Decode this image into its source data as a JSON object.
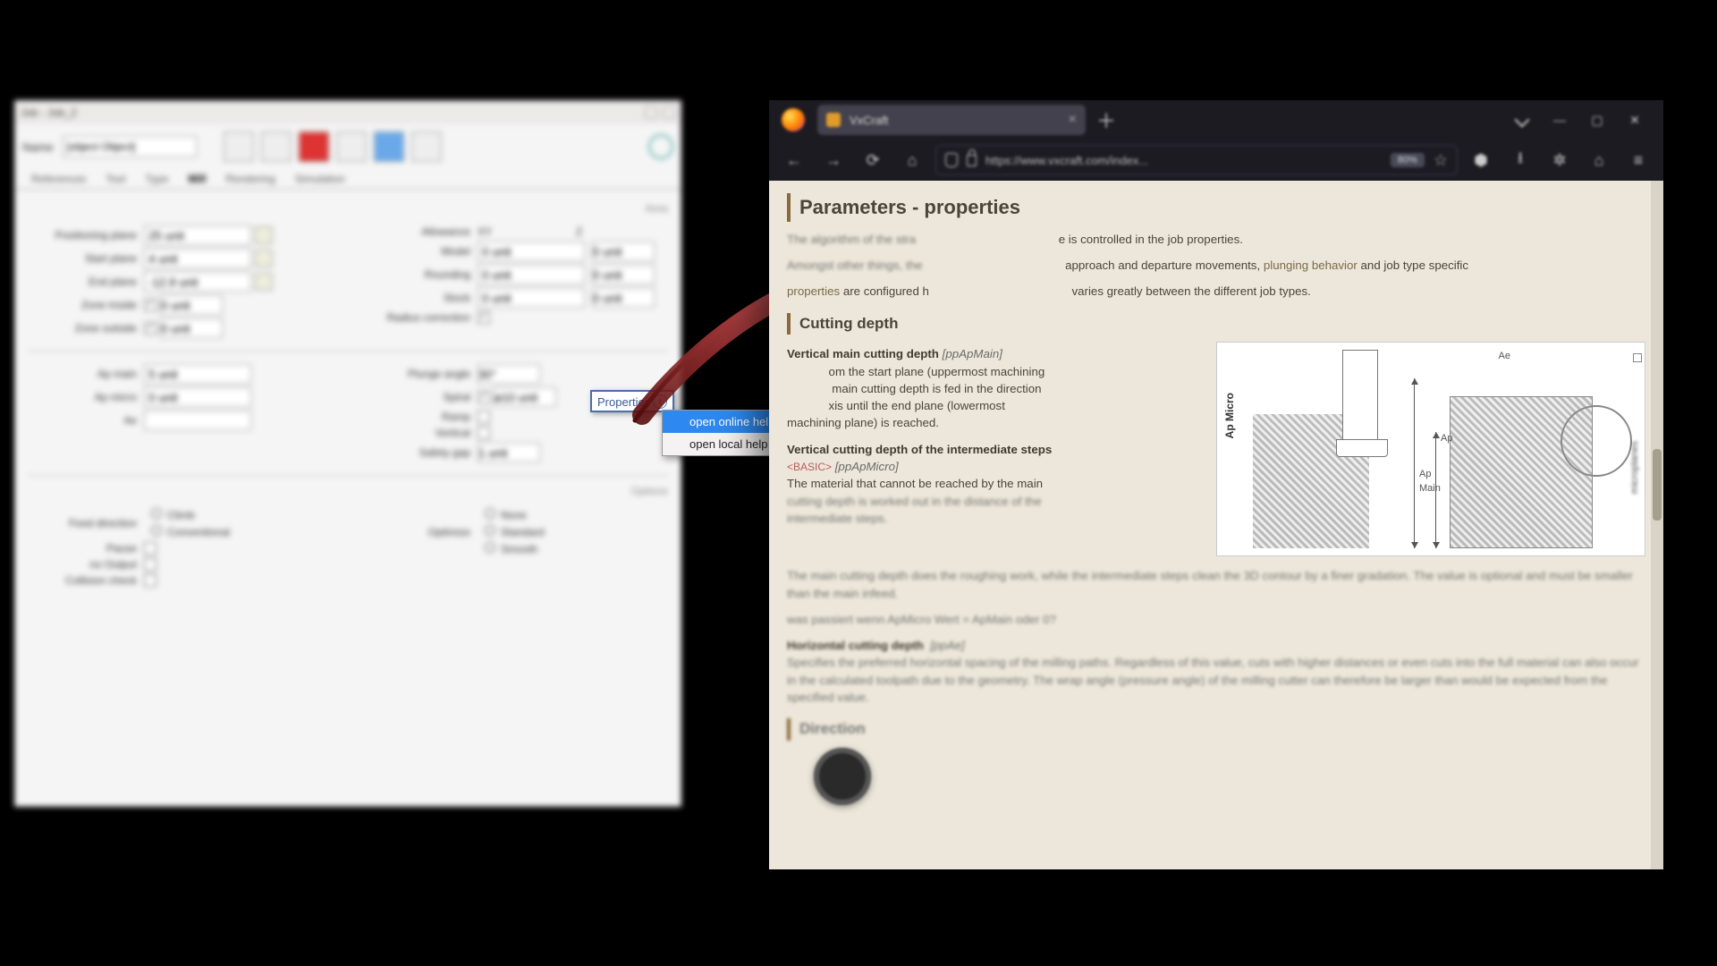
{
  "app": {
    "title": "Job - Job_2",
    "name_label": "Name",
    "name_value": "Job_2",
    "tabs": [
      "References",
      "Tool",
      "Type",
      "Mill",
      "Rendering",
      "Simulation"
    ],
    "active_tab": 3,
    "section_area": "Area",
    "labels": {
      "positioning_plane": "Positioning plane",
      "start_plane": "Start plane",
      "end_plane": "End plane",
      "zone_inside": "Zone inside",
      "zone_outside": "Zone outside",
      "allowance": "Allowance",
      "model": "Model",
      "rounding": "Rounding",
      "stock": "Stock",
      "radius_correction": "Radius correction",
      "ap_main": "Ap main",
      "ap_micro": "Ap micro",
      "ae": "Ae",
      "plunge_angle": "Plunge angle",
      "spiral": "Spiral",
      "ramp": "Ramp",
      "vertical": "Vertical",
      "safety_gap": "Safety gap",
      "feed_direction": "Feed direction",
      "climb": "Climb",
      "conventional": "Conventional",
      "pause": "Pause",
      "no_output": "no Output",
      "collision_check": "Collision check",
      "optimize": "Optimize",
      "none": "None",
      "standard": "Standard",
      "smooth": "Smooth",
      "section_optimize": "Options"
    },
    "values": {
      "positioning_plane": "25 unit",
      "start_plane": "4 unit",
      "end_plane": "-12.9 unit",
      "zone_inside": "0 unit",
      "zone_outside": "0 unit",
      "allowance_xy": "XY",
      "allowance_z": "Z",
      "model": "0 unit",
      "model_z": "0 unit",
      "rounding": "0 unit",
      "rounding_z": "0 unit",
      "stock": "0 unit",
      "stock_z": "0 unit",
      "plunge_angle": "30°",
      "spiral_val": "ø10 unit",
      "ap_main": "5 unit",
      "ap_micro": "0 unit",
      "ae": "",
      "safety_gap": "1 unit"
    }
  },
  "popover": {
    "title": "Properties",
    "menu": {
      "open_online": "open online help",
      "open_local": "open local help"
    }
  },
  "browser": {
    "tab_title": "VxCraft",
    "url": "https://www.vxcraft.com/index...",
    "zoom": "80%"
  },
  "doc": {
    "h1": "Parameters - properties",
    "intro1_a": "The algorithm of the stra",
    "intro1_b": "e is controlled in the job properties.",
    "intro2_a": "Amongst other things, the",
    "intro2_b": "approach and departure movements, ",
    "intro2_link": "plunging behavior",
    "intro2_c": " and job type specific",
    "intro3_a": "properties",
    "intro3_b": " are configured h",
    "intro3_c": "varies greatly between the different job types.",
    "h2a": "Cutting depth",
    "vmcd_title": "Vertical main cutting depth",
    "vmcd_key": "[ppApMain]",
    "vmcd_body_a": "om the start plane (uppermost machining",
    "vmcd_body_b": " main cutting depth is fed in the direction",
    "vmcd_body_c": "xis until the end plane (lowermost",
    "vmcd_body_d": "machining plane) is reached.",
    "vcis_title": "Vertical cutting depth of the intermediate steps",
    "vcis_badge": "<BASIC>",
    "vcis_key": "[ppApMicro]",
    "vcis_body_a": "The material that cannot be reached by the main",
    "vcis_body_b": "cutting depth is worked out in the distance of the",
    "vcis_body_c": "intermediate steps.",
    "blur1": "The main cutting depth does the roughing work, while the intermediate steps clean the 3D contour by a finer gradation. The value is optional and must be smaller than the main infeed.",
    "blur2": "was passiert wenn ApMicro Wert = ApMain oder 0?",
    "hcd_title": "Horizontal cutting depth",
    "hcd_key": "[ppAe]",
    "hcd_body": "Specifies the preferred horizontal spacing of the milling paths. Regardless of this value, cuts with higher distances or even cuts into the full material can also occur in the calculated toolpath due to the geometry. The wrap angle (pressure angle) of the milling cutter can therefore be larger than would be expected from the specified value.",
    "h2b": "Direction",
    "diagram_labels": {
      "ap_micro": "Ap Micro",
      "ap_main": "Ap\nMain",
      "ap": "Ap",
      "ae": "Ae",
      "microplanes": "microplanes"
    }
  }
}
